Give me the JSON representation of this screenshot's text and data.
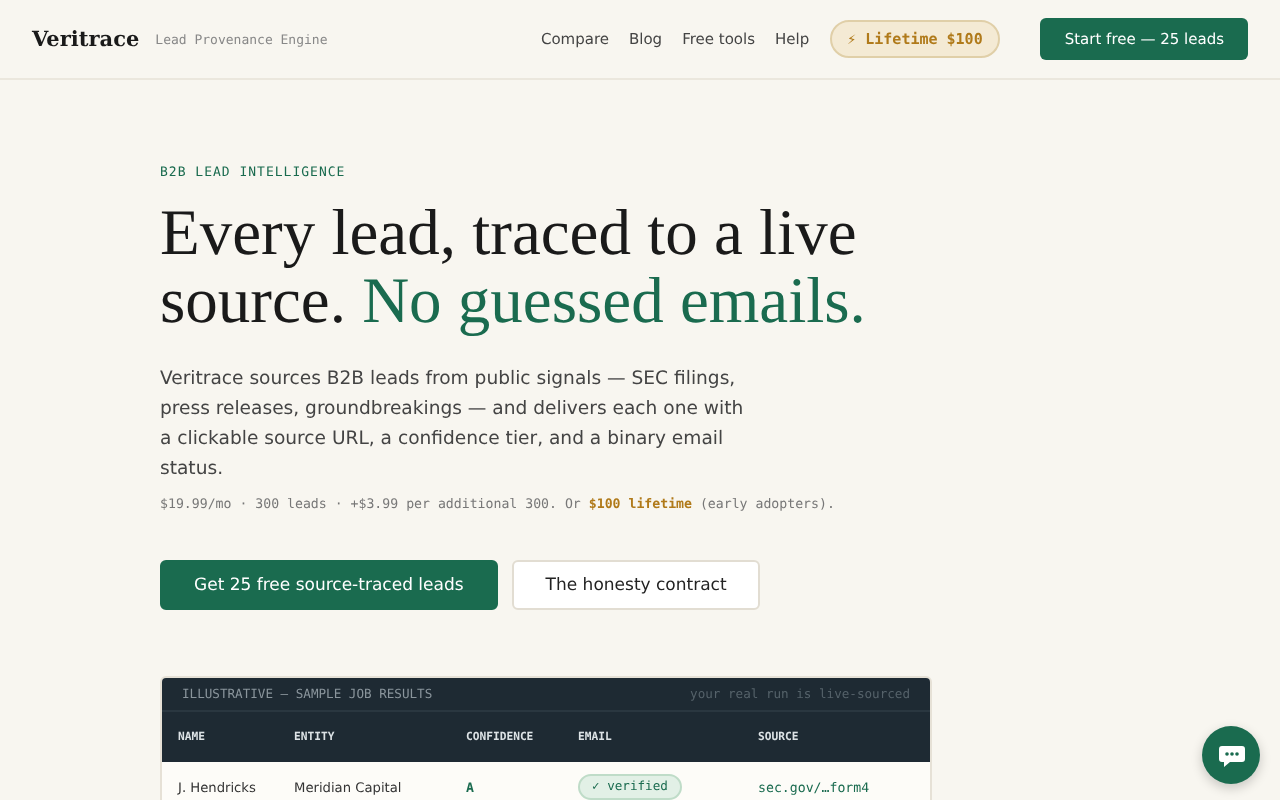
{
  "header": {
    "brand": "Veritrace",
    "tagline": "Lead Provenance Engine",
    "nav": [
      "Compare",
      "Blog",
      "Free tools",
      "Help"
    ],
    "lifetime_badge": {
      "icon": "⚡",
      "label": "Lifetime $100"
    },
    "cta": "Start free — 25 leads"
  },
  "hero": {
    "eyebrow": "B2B LEAD INTELLIGENCE",
    "headline": "Every lead, traced to a live source.",
    "headline_accent": "No guessed emails.",
    "description": "Veritrace sources B2B leads from public signals — SEC filings, press releases, groundbreakings — and delivers each one with a clickable source URL, a confidence tier, and a binary email status.",
    "pricing": "$19.99/mo · 300 leads · +$3.99 per additional 300. Or **$100 lifetime** (early adopters).",
    "buttons": [
      {
        "label": "Get 25 free source-traced leads",
        "kind": "primary"
      },
      {
        "label": "The honesty contract",
        "kind": "secondary"
      }
    ]
  },
  "sample_table": {
    "title": "ILLUSTRATIVE — SAMPLE JOB RESULTS",
    "note": "your real run is live-sourced",
    "columns": [
      "NAME",
      "ENTITY",
      "CONFIDENCE",
      "EMAIL",
      "SOURCE"
    ],
    "rows": [
      {
        "name": "J. Hendricks",
        "entity": "Meridian Capital",
        "confidence": "A",
        "email": {
          "icon": "✓",
          "label": "verified",
          "verified": true
        },
        "source": "sec.gov/…form4"
      }
    ]
  }
}
